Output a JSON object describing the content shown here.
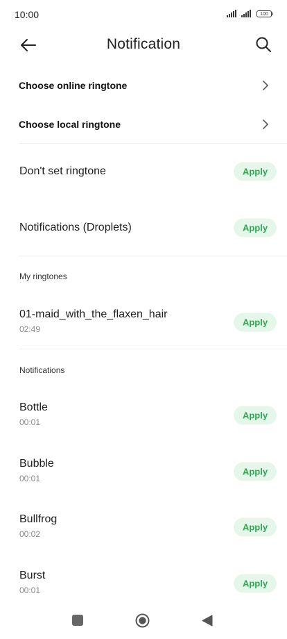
{
  "status_bar": {
    "time": "10:00",
    "battery": "100"
  },
  "header": {
    "title": "Notification",
    "back_icon": "arrow-left-icon",
    "search_icon": "search-icon"
  },
  "nav_items": [
    {
      "label": "Choose online ringtone"
    },
    {
      "label": "Choose local ringtone"
    }
  ],
  "top_options": [
    {
      "name": "Don't set ringtone",
      "action": "Apply"
    },
    {
      "name": "Notifications (Droplets)",
      "action": "Apply"
    }
  ],
  "my_ringtones": {
    "header": "My ringtones",
    "items": [
      {
        "name": "01-maid_with_the_flaxen_hair",
        "duration": "02:49",
        "action": "Apply"
      }
    ]
  },
  "notifications": {
    "header": "Notifications",
    "items": [
      {
        "name": "Bottle",
        "duration": "00:01",
        "action": "Apply"
      },
      {
        "name": "Bubble",
        "duration": "00:01",
        "action": "Apply"
      },
      {
        "name": "Bullfrog",
        "duration": "00:02",
        "action": "Apply"
      },
      {
        "name": "Burst",
        "duration": "00:01",
        "action": "Apply"
      }
    ]
  },
  "colors": {
    "apply_bg": "#e5f6ea",
    "apply_text": "#2eaa4f"
  },
  "system_nav": {
    "recents_icon": "square-icon",
    "home_icon": "circle-icon",
    "back_icon": "triangle-back-icon"
  }
}
